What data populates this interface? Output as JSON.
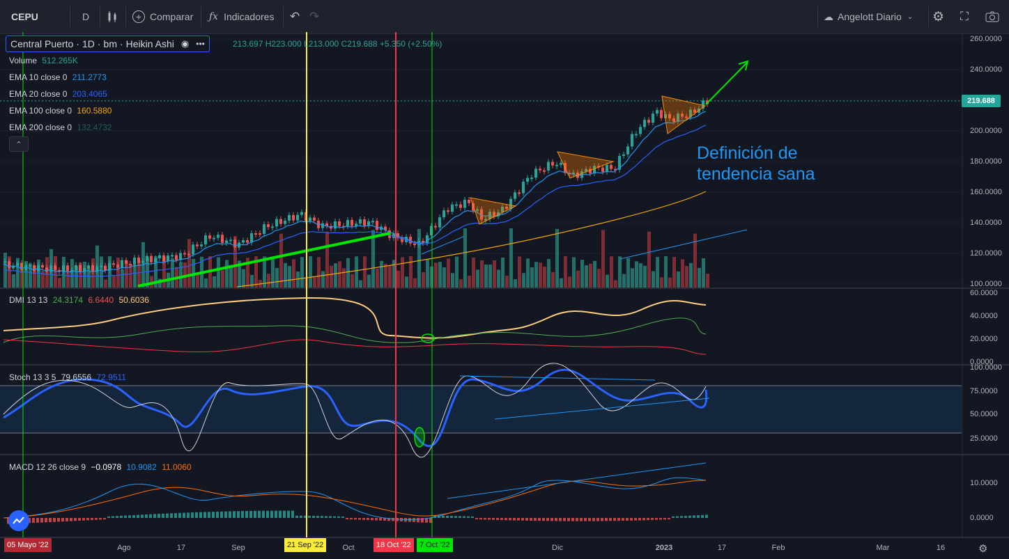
{
  "toolbar": {
    "symbol": "CEPU",
    "interval": "D",
    "compare_label": "Comparar",
    "indicators_label": "Indicadores",
    "layout_name": "Angelott Diario"
  },
  "legend": {
    "main": {
      "name": "Central Puerto",
      "interval": "1D",
      "exchange": "bm",
      "chart_type": "Heikin Ashi"
    },
    "ohlc": {
      "o": "213.697",
      "h": "H223.000",
      "l": "L213.000",
      "c": "C219.688",
      "change": "+5.350 (+2.50%)"
    },
    "volume": {
      "label": "Volume",
      "value": "512.265K"
    },
    "ema": [
      {
        "label": "EMA 10 close 0",
        "value": "211.2773",
        "color": "#2196f3"
      },
      {
        "label": "EMA 20 close 0",
        "value": "203.4065",
        "color": "#2962ff"
      },
      {
        "label": "EMA 100 close 0",
        "value": "160.5880",
        "color": "#f7a600"
      },
      {
        "label": "EMA 200 close 0",
        "value": "132.4732",
        "color": "#26a69a"
      }
    ],
    "collapse_glyph": "⌃"
  },
  "price_scale": [
    "260.0000",
    "240.0000",
    "220.0000",
    "200.0000",
    "180.0000",
    "160.0000",
    "140.0000",
    "120.0000",
    "100.0000"
  ],
  "current_price": "219.688",
  "annotation": [
    "Definición de",
    "tendencia sana"
  ],
  "dmi": {
    "label": "DMI 13 13",
    "v1": "24.3174",
    "v2": "6.6440",
    "v3": "50.6036",
    "scale": [
      "60.0000",
      "40.0000",
      "20.0000",
      "0.0000"
    ]
  },
  "stoch": {
    "label": "Stoch 13 3 5",
    "k": "79.6556",
    "d": "72.9511",
    "scale": [
      "100.0000",
      "75.0000",
      "50.0000",
      "25.0000"
    ]
  },
  "macd": {
    "label": "MACD 12 26 close 9",
    "hist": "−0.0978",
    "macd": "10.9082",
    "signal": "11.0060",
    "scale": [
      "10.0000",
      "0.0000"
    ]
  },
  "time_axis": [
    "Ago",
    "17",
    "Sep",
    "Oct",
    "Dic",
    "2023",
    "17",
    "Feb",
    "Mar",
    "16"
  ],
  "time_markers": [
    {
      "label": "05 Mayo '22",
      "bg": "#b22833",
      "fg": "#ffffff"
    },
    {
      "label": "21 Sep '22",
      "bg": "#ffeb3b",
      "fg": "#131722"
    },
    {
      "label": "18 Oct '22",
      "bg": "#f23645",
      "fg": "#ffffff"
    },
    {
      "label": "7 Oct '22",
      "bg": "#00e600",
      "fg": "#131722"
    }
  ],
  "colors": {
    "bull": "#26a69a",
    "bear": "#ef5350",
    "vol_bull": "#22706a",
    "vol_bear": "#7e2d34",
    "trend": "#00e600",
    "ema10": "#2196f3",
    "ema20": "#2962ff",
    "ema100": "#f7a600"
  }
}
